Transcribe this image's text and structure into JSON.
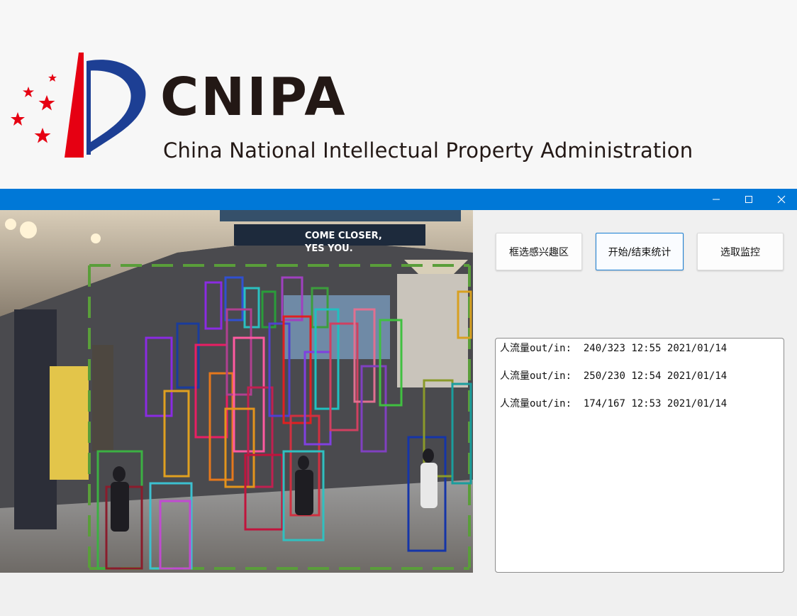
{
  "header": {
    "logo": {
      "wordmark": "CNIPA",
      "full_name": "China National Intellectual Property Administration",
      "colors": {
        "red": "#e60012",
        "blue": "#1d3f94",
        "text": "#231815"
      }
    }
  },
  "window": {
    "titlebar_color": "#0078d7",
    "controls": {
      "minimize_icon": "minimize-icon",
      "maximize_icon": "maximize-icon",
      "close_icon": "close-icon"
    }
  },
  "video": {
    "description_icon": "camera-feed",
    "region_of_interest_color": "#5a9e3a"
  },
  "toolbar": {
    "select_region_label": "框选感兴趣区",
    "start_stop_label": "开始/结束统计",
    "choose_monitor_label": "选取监控"
  },
  "log": {
    "entries": [
      {
        "label": "人流量out/in:",
        "counts": "240/323",
        "time": "12:55",
        "date": "2021/01/14"
      },
      {
        "label": "人流量out/in:",
        "counts": "250/230",
        "time": "12:54",
        "date": "2021/01/14"
      },
      {
        "label": "人流量out/in:",
        "counts": "174/167",
        "time": "12:53",
        "date": "2021/01/14"
      }
    ]
  }
}
